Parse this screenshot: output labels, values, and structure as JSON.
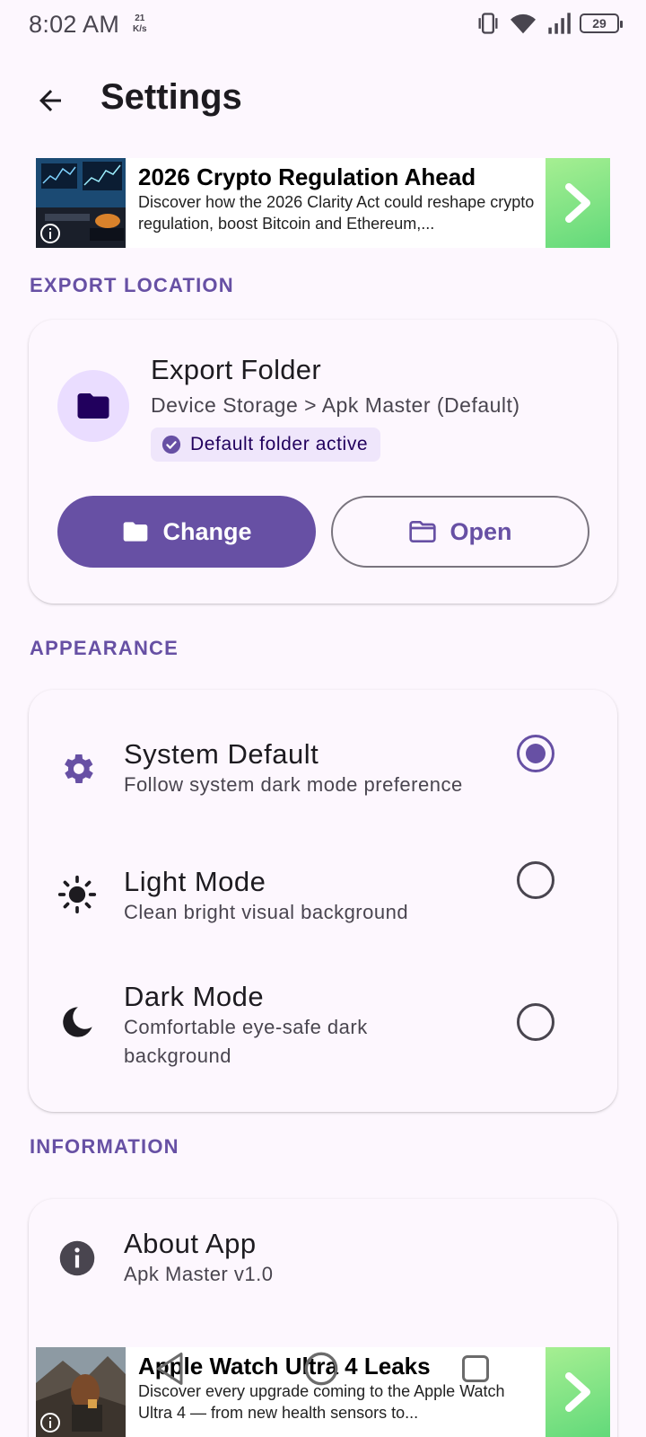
{
  "status_bar": {
    "time": "8:02 AM",
    "net_speed_value": "21",
    "net_speed_unit": "K/s",
    "battery": "29",
    "icons": [
      "vibrate-icon",
      "wifi-icon",
      "signal-icon",
      "battery-icon"
    ]
  },
  "app_bar": {
    "title": "Settings",
    "back_icon": "arrow-left-icon"
  },
  "ad_top": {
    "title": "2026 Crypto Regulation Ahead",
    "description": "Discover how the 2026 Clarity Act could reshape crypto regulation, boost Bitcoin and Ethereum,..."
  },
  "export_section": {
    "header": "EXPORT LOCATION",
    "folder_title": "Export Folder",
    "folder_path": "Device Storage > Apk Master (Default)",
    "chip_label": "Default folder active",
    "change_label": "Change",
    "open_label": "Open"
  },
  "appearance_section": {
    "header": "APPEARANCE",
    "options": [
      {
        "title": "System Default",
        "subtitle": "Follow system dark mode preference",
        "icon": "settings-brightness-icon",
        "selected": true
      },
      {
        "title": "Light Mode",
        "subtitle": "Clean bright visual background",
        "icon": "sun-icon",
        "selected": false
      },
      {
        "title": "Dark Mode",
        "subtitle": "Comfortable eye-safe dark background",
        "icon": "moon-icon",
        "selected": false
      }
    ]
  },
  "info_section": {
    "header": "INFORMATION",
    "about_title": "About App",
    "about_subtitle": "Apk Master v1.0"
  },
  "ad_bottom": {
    "title": "Apple Watch Ultra 4 Leaks",
    "description": "Discover every upgrade coming to the Apple Watch Ultra 4 — from new health sensors to..."
  },
  "colors": {
    "primary": "#6750a4",
    "background": "#fdf7fe",
    "chip_bg": "#efe6fb",
    "ad_cta": "#62d97a"
  }
}
